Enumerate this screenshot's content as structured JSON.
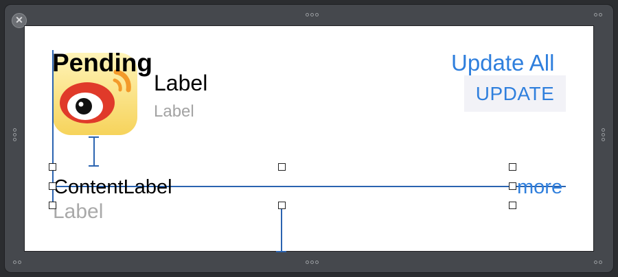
{
  "window": {
    "close_icon_glyph": "✕"
  },
  "cell": {
    "title": "Pending",
    "app_name_label": "Label",
    "app_sub_label": "Label",
    "update_all_label": "Update All",
    "update_button_label": "UPDATE",
    "content_label": "ContentLabel",
    "bottom_label": "Label",
    "more_label": "more"
  },
  "icons": {
    "app_icon": "weibo-app-icon"
  },
  "colors": {
    "accent": "#2f7fdd",
    "secondary_text": "#a3a3a3",
    "constraint": "#2a63b0",
    "canvas_bg": "#ffffff",
    "chrome_bg": "#45484d"
  }
}
